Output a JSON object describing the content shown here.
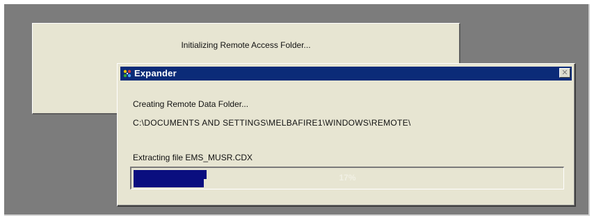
{
  "background_dialog": {
    "message": "Initializing Remote Access Folder..."
  },
  "expander_window": {
    "title": "Expander",
    "title_icon": "app-icon",
    "close_icon": "close-icon",
    "close_label": "✕",
    "status": "Creating Remote Data Folder...",
    "path": "C:\\DOCUMENTS AND SETTINGS\\MELBAFIRE1\\WINDOWS\\REMOTE\\",
    "extracting_label": "Extracting file EMS_MUSR.CDX",
    "progress": {
      "percent": 17,
      "label": "17%"
    }
  },
  "colors": {
    "desktop": "#7c7c7c",
    "dialog_face": "#e7e5d2",
    "titlebar": "#0b2b78",
    "progress_fill": "#0a0e7f"
  }
}
